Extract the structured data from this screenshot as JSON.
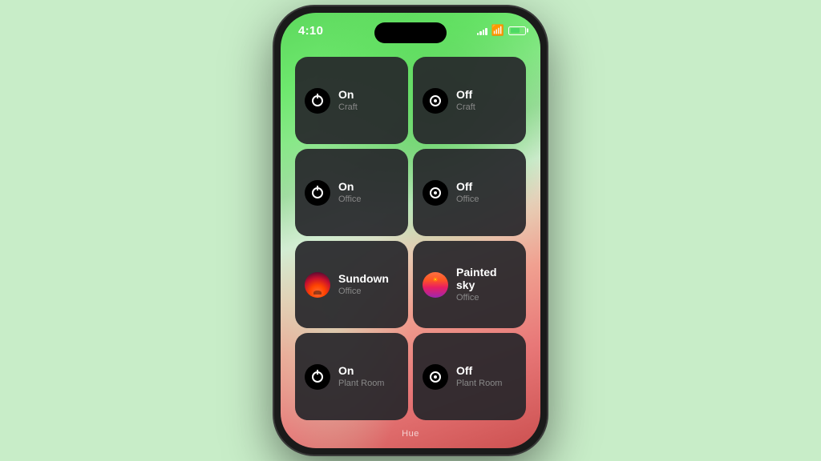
{
  "statusBar": {
    "time": "4:10",
    "battery": "60"
  },
  "hueLabel": "Hue",
  "widgets": [
    [
      {
        "id": "on-craft",
        "type": "on",
        "title": "On",
        "subtitle": "Craft",
        "icon": "on"
      },
      {
        "id": "off-craft",
        "type": "off",
        "title": "Off",
        "subtitle": "Craft",
        "icon": "off"
      }
    ],
    [
      {
        "id": "on-office",
        "type": "on",
        "title": "On",
        "subtitle": "Office",
        "icon": "on"
      },
      {
        "id": "off-office",
        "type": "off",
        "title": "Off",
        "subtitle": "Office",
        "icon": "off"
      }
    ],
    [
      {
        "id": "sundown-office",
        "type": "scene",
        "title": "Sundown",
        "subtitle": "Office",
        "icon": "sundown"
      },
      {
        "id": "painted-sky-office",
        "type": "scene",
        "title": "Painted sky",
        "subtitle": "Office",
        "icon": "painted-sky"
      }
    ],
    [
      {
        "id": "on-plant-room",
        "type": "on",
        "title": "On",
        "subtitle": "Plant Room",
        "icon": "on"
      },
      {
        "id": "off-plant-room",
        "type": "off",
        "title": "Off",
        "subtitle": "Plant Room",
        "icon": "off"
      }
    ]
  ]
}
